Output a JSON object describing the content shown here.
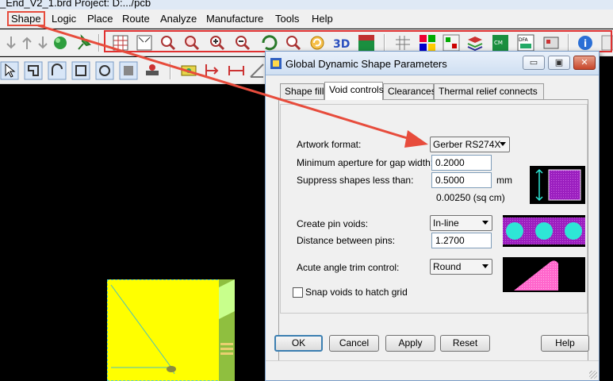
{
  "app": {
    "title": "_End_V2_1.brd  Project: D:.../pcb"
  },
  "menu": {
    "items": [
      "Shape",
      "Logic",
      "Place",
      "Route",
      "Analyze",
      "Manufacture",
      "Tools",
      "Help"
    ],
    "highlighted": "Shape"
  },
  "dialog": {
    "title": "Global Dynamic Shape Parameters",
    "window_buttons": {
      "minimize": "▭",
      "restore": "▣",
      "close": "✕"
    },
    "tabs": [
      "Shape fill",
      "Void controls",
      "Clearances",
      "Thermal relief connects"
    ],
    "active_tab": "Void controls",
    "artwork_format": {
      "label": "Artwork format:",
      "value": "Gerber RS274X"
    },
    "min_aperture": {
      "label": "Minimum aperture for gap width:",
      "value": "0.2000"
    },
    "suppress_shapes": {
      "label": "Suppress shapes less than:",
      "value": "0.5000",
      "unit": "mm",
      "area": "0.00250 (sq cm)"
    },
    "create_pin_voids": {
      "label": "Create pin voids:",
      "value": "In-line"
    },
    "distance_between_pins": {
      "label": "Distance between pins:",
      "value": "1.2700"
    },
    "acute_angle_trim": {
      "label": "Acute angle trim control:",
      "value": "Round"
    },
    "snap_voids": {
      "label": "Snap voids to hatch grid",
      "checked": false
    },
    "buttons": {
      "ok": "OK",
      "cancel": "Cancel",
      "apply": "Apply",
      "reset": "Reset",
      "help": "Help"
    }
  },
  "colors": {
    "annotation_red": "#e74c3c",
    "canvas_yellow": "#ffff00",
    "preview_purple": "#9b1fbf",
    "preview_cyan": "#2ee6d6",
    "preview_pink": "#ff66cc"
  }
}
